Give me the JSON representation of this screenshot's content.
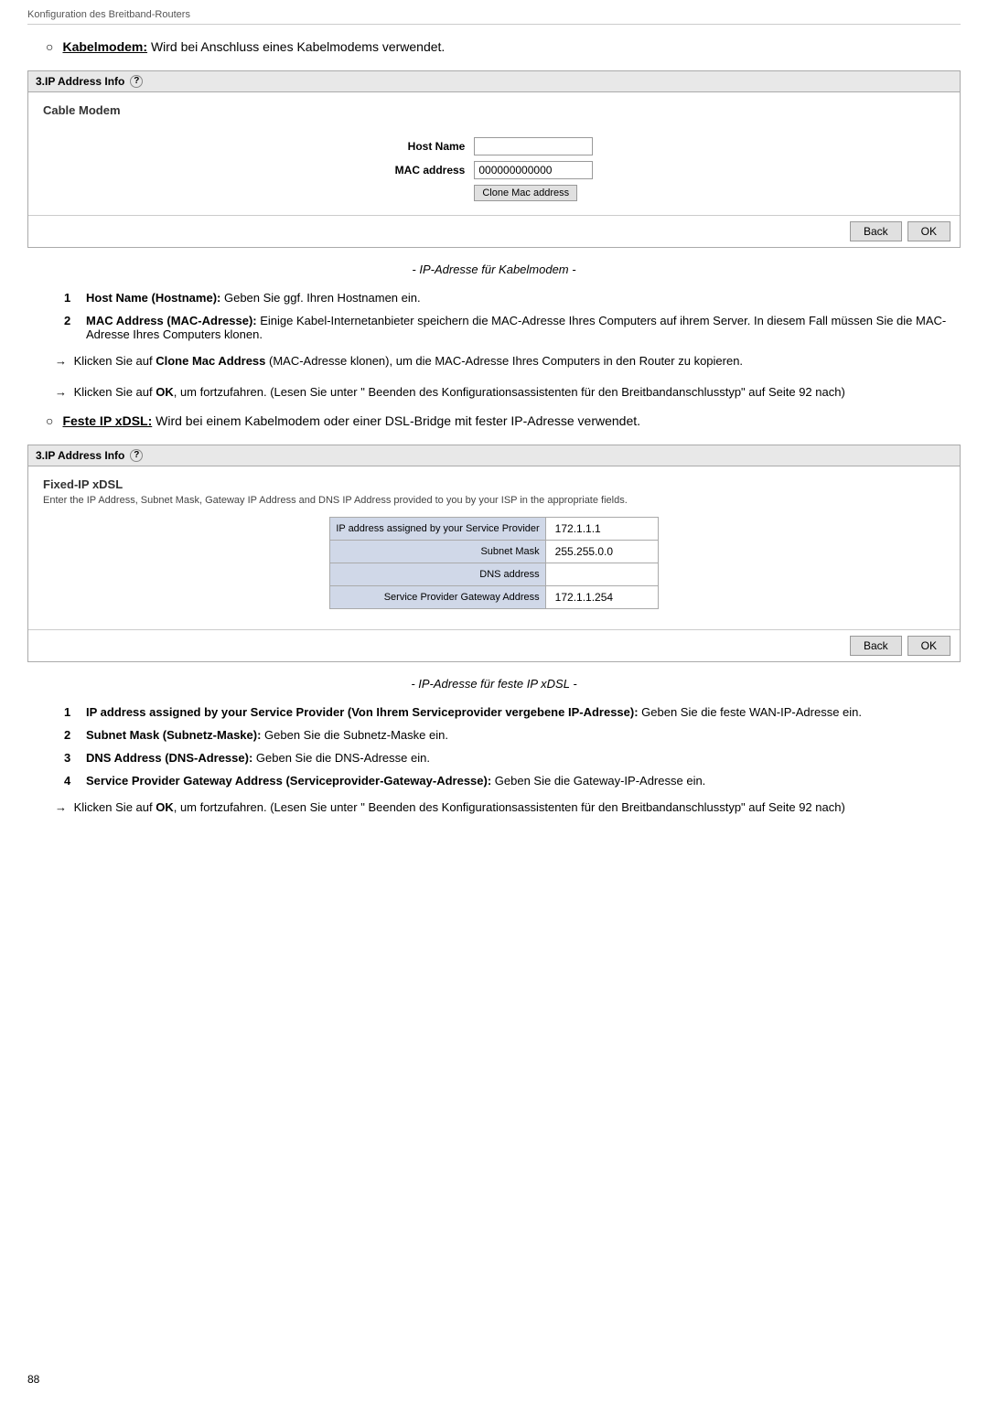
{
  "page": {
    "header": "Konfiguration des Breitband-Routers",
    "page_number": "88"
  },
  "kabelmodem_section": {
    "bullet": "○",
    "title": "Kabelmodem:",
    "description": "Wird bei Anschluss eines Kabelmodems verwendet."
  },
  "panel1": {
    "header": "3.IP Address Info",
    "section_title": "Cable Modem",
    "host_name_label": "Host Name",
    "host_name_value": "",
    "mac_address_label": "MAC address",
    "mac_address_value": "000000000000",
    "clone_button": "Clone Mac address",
    "back_button": "Back",
    "ok_button": "OK"
  },
  "caption1": "- IP-Adresse für Kabelmodem -",
  "instructions1": [
    {
      "num": "1",
      "text_bold": "Host Name (Hostname):",
      "text": " Geben Sie ggf. Ihren Hostnamen ein."
    },
    {
      "num": "2",
      "text_bold": "MAC Address (MAC-Adresse):",
      "text": " Einige Kabel-Internetanbieter speichern die MAC-Adresse Ihres Computers auf ihrem Server. In diesem Fall müssen Sie die MAC-Adresse Ihres Computers klonen."
    }
  ],
  "clone_instruction": {
    "arrow": "→",
    "text": "Klicken Sie auf ",
    "bold": "Clone Mac Address",
    "text2": " (MAC-Adresse klonen), um die MAC-Adresse Ihres Computers in den Router zu kopieren."
  },
  "ok_instruction1": {
    "text": "Klicken Sie auf ",
    "bold": "OK",
    "text2": ", um fortzufahren. (Lesen Sie unter \" Beenden des Konfigurationsassistenten für den Breitbandanschlusstyp\"  auf Seite  92 nach)"
  },
  "festeip_section": {
    "bullet": "○",
    "title": "Feste IP xDSL:",
    "description": "Wird bei einem Kabelmodem oder einer DSL-Bridge mit fester IP-Adresse verwendet."
  },
  "panel2": {
    "header": "3.IP Address Info",
    "section_title": "Fixed-IP xDSL",
    "description": "Enter the IP Address, Subnet Mask, Gateway IP Address and DNS IP Address provided to you by your ISP in the appropriate fields.",
    "fields": [
      {
        "label": "IP address assigned by your Service Provider",
        "value": "172.1.1.1"
      },
      {
        "label": "Subnet Mask",
        "value": "255.255.0.0"
      },
      {
        "label": "DNS address",
        "value": ""
      },
      {
        "label": "Service Provider Gateway Address",
        "value": "172.1.1.254"
      }
    ],
    "back_button": "Back",
    "ok_button": "OK"
  },
  "caption2": "- IP-Adresse für feste IP xDSL -",
  "instructions2": [
    {
      "num": "1",
      "text_bold": "IP address assigned by your Service Provider (Von Ihrem Serviceprovider vergebene IP-Adresse):",
      "text": " Geben Sie die feste WAN-IP-Adresse ein."
    },
    {
      "num": "2",
      "text_bold": "Subnet Mask (Subnetz-Maske):",
      "text": " Geben Sie die Subnetz-Maske ein."
    },
    {
      "num": "3",
      "text_bold": "DNS Address (DNS-Adresse):",
      "text": " Geben Sie die DNS-Adresse ein."
    },
    {
      "num": "4",
      "text_bold": "Service Provider Gateway Address (Serviceprovider-Gateway-Adresse):",
      "text": " Geben Sie die Gateway-IP-Adresse ein."
    }
  ],
  "ok_instruction2": {
    "text": "Klicken Sie auf ",
    "bold": "OK",
    "text2": ", um fortzufahren. (Lesen Sie unter \" Beenden des Konfigurationsassistenten für den Breitbandanschlusstyp\"  auf Seite  92 nach)"
  }
}
